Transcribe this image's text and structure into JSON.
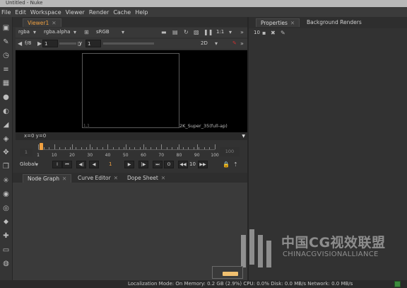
{
  "window": {
    "title": "Untitled - Nuke"
  },
  "menu": [
    "File",
    "Edit",
    "Workspace",
    "Viewer",
    "Render",
    "Cache",
    "Help"
  ],
  "viewer": {
    "tab_label": "Viewer1",
    "channels": "rgba",
    "alpha_channel": "rgba.alpha",
    "colorspace": "sRGB",
    "zoom": "1:1",
    "fstop": "f/8",
    "gain": "1",
    "gamma_label": "y",
    "gamma": "1",
    "view_mode": "2D",
    "format_label": "2K_Super_35(full-ap)",
    "origin_label": "1,1",
    "coords": "x=0 y=0"
  },
  "timeline": {
    "start": "1",
    "end": "100",
    "current_frame": "1",
    "ticks": [
      "1",
      "10",
      "20",
      "30",
      "40",
      "50",
      "60",
      "70",
      "80",
      "90",
      "100"
    ],
    "scope": "Global",
    "step": "10"
  },
  "nodegraph_tabs": [
    "Node Graph",
    "Curve Editor",
    "Dope Sheet"
  ],
  "properties": {
    "tabs": [
      "Properties",
      "Background Renders"
    ],
    "max_panels": "10"
  },
  "watermark": {
    "chinese": "中国CG视效联盟",
    "english": "CHINACGVISIONALLIANCE"
  },
  "status": {
    "localization_mode": "Localization Mode: On",
    "memory": "Memory: 0.2 GB (2.9%)",
    "cpu": "CPU: 0.0%",
    "disk": "Disk: 0.0 MB/s",
    "network": "Network: 0.0 MB/s"
  },
  "colors": {
    "accent": "#f0a040",
    "background": "#323232",
    "viewport": "#000000"
  }
}
